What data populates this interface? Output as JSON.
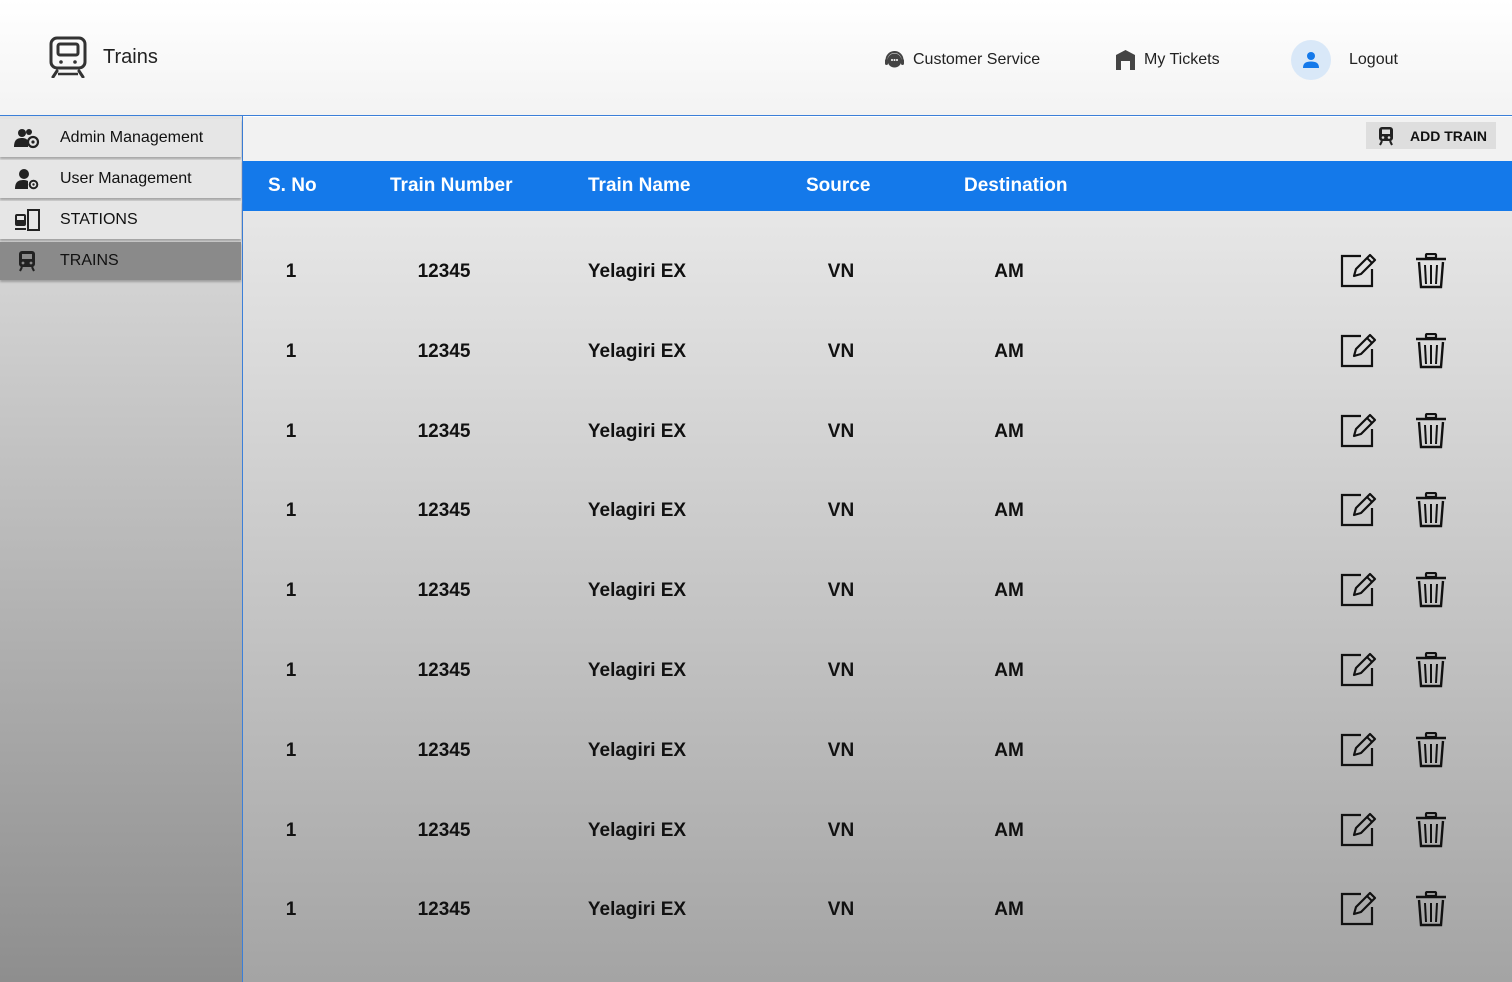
{
  "header": {
    "title": "Trains",
    "customer_service": "Customer Service",
    "my_tickets": "My Tickets",
    "logout": "Logout"
  },
  "sidebar": {
    "items": [
      {
        "label": "Admin Management",
        "icon": "admin-group-icon"
      },
      {
        "label": "User Management",
        "icon": "user-gear-icon"
      },
      {
        "label": "STATIONS",
        "icon": "station-icon"
      },
      {
        "label": "TRAINS",
        "icon": "train-icon",
        "active": true
      }
    ]
  },
  "toolbar": {
    "add_label": "ADD TRAIN"
  },
  "table": {
    "columns": [
      "S. No",
      "Train Number",
      "Train Name",
      "Source",
      "Destination"
    ],
    "rows": [
      [
        "1",
        "12345",
        "Yelagiri EX",
        "VN",
        "AM"
      ],
      [
        "1",
        "12345",
        "Yelagiri EX",
        "VN",
        "AM"
      ],
      [
        "1",
        "12345",
        "Yelagiri EX",
        "VN",
        "AM"
      ],
      [
        "1",
        "12345",
        "Yelagiri EX",
        "VN",
        "AM"
      ],
      [
        "1",
        "12345",
        "Yelagiri EX",
        "VN",
        "AM"
      ],
      [
        "1",
        "12345",
        "Yelagiri EX",
        "VN",
        "AM"
      ],
      [
        "1",
        "12345",
        "Yelagiri EX",
        "VN",
        "AM"
      ],
      [
        "1",
        "12345",
        "Yelagiri EX",
        "VN",
        "AM"
      ],
      [
        "1",
        "12345",
        "Yelagiri EX",
        "VN",
        "AM"
      ]
    ]
  },
  "colors": {
    "accent": "#1479ea",
    "border": "#3b7fd8",
    "avatar_bg": "#d9e8f8"
  }
}
